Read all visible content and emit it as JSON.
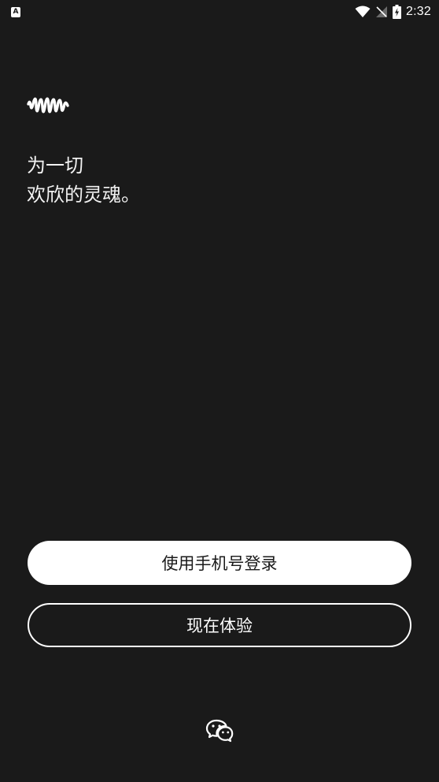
{
  "status_bar": {
    "notification_glyph": "A",
    "time": "2:32",
    "icons": [
      "wifi-icon",
      "signal-off-icon",
      "battery-charging-icon"
    ]
  },
  "logo": {
    "icon": "soundwave-logo-icon"
  },
  "tagline": {
    "line1": "为一切",
    "line2": "欢欣的灵魂。"
  },
  "buttons": {
    "phone_login": "使用手机号登录",
    "try_now": "现在体验"
  },
  "wechat": {
    "icon": "wechat-icon"
  },
  "colors": {
    "background": "#1a1a1a",
    "primary_button_bg": "#ffffff",
    "primary_button_text": "#1a1a1a",
    "text": "#ffffff"
  }
}
